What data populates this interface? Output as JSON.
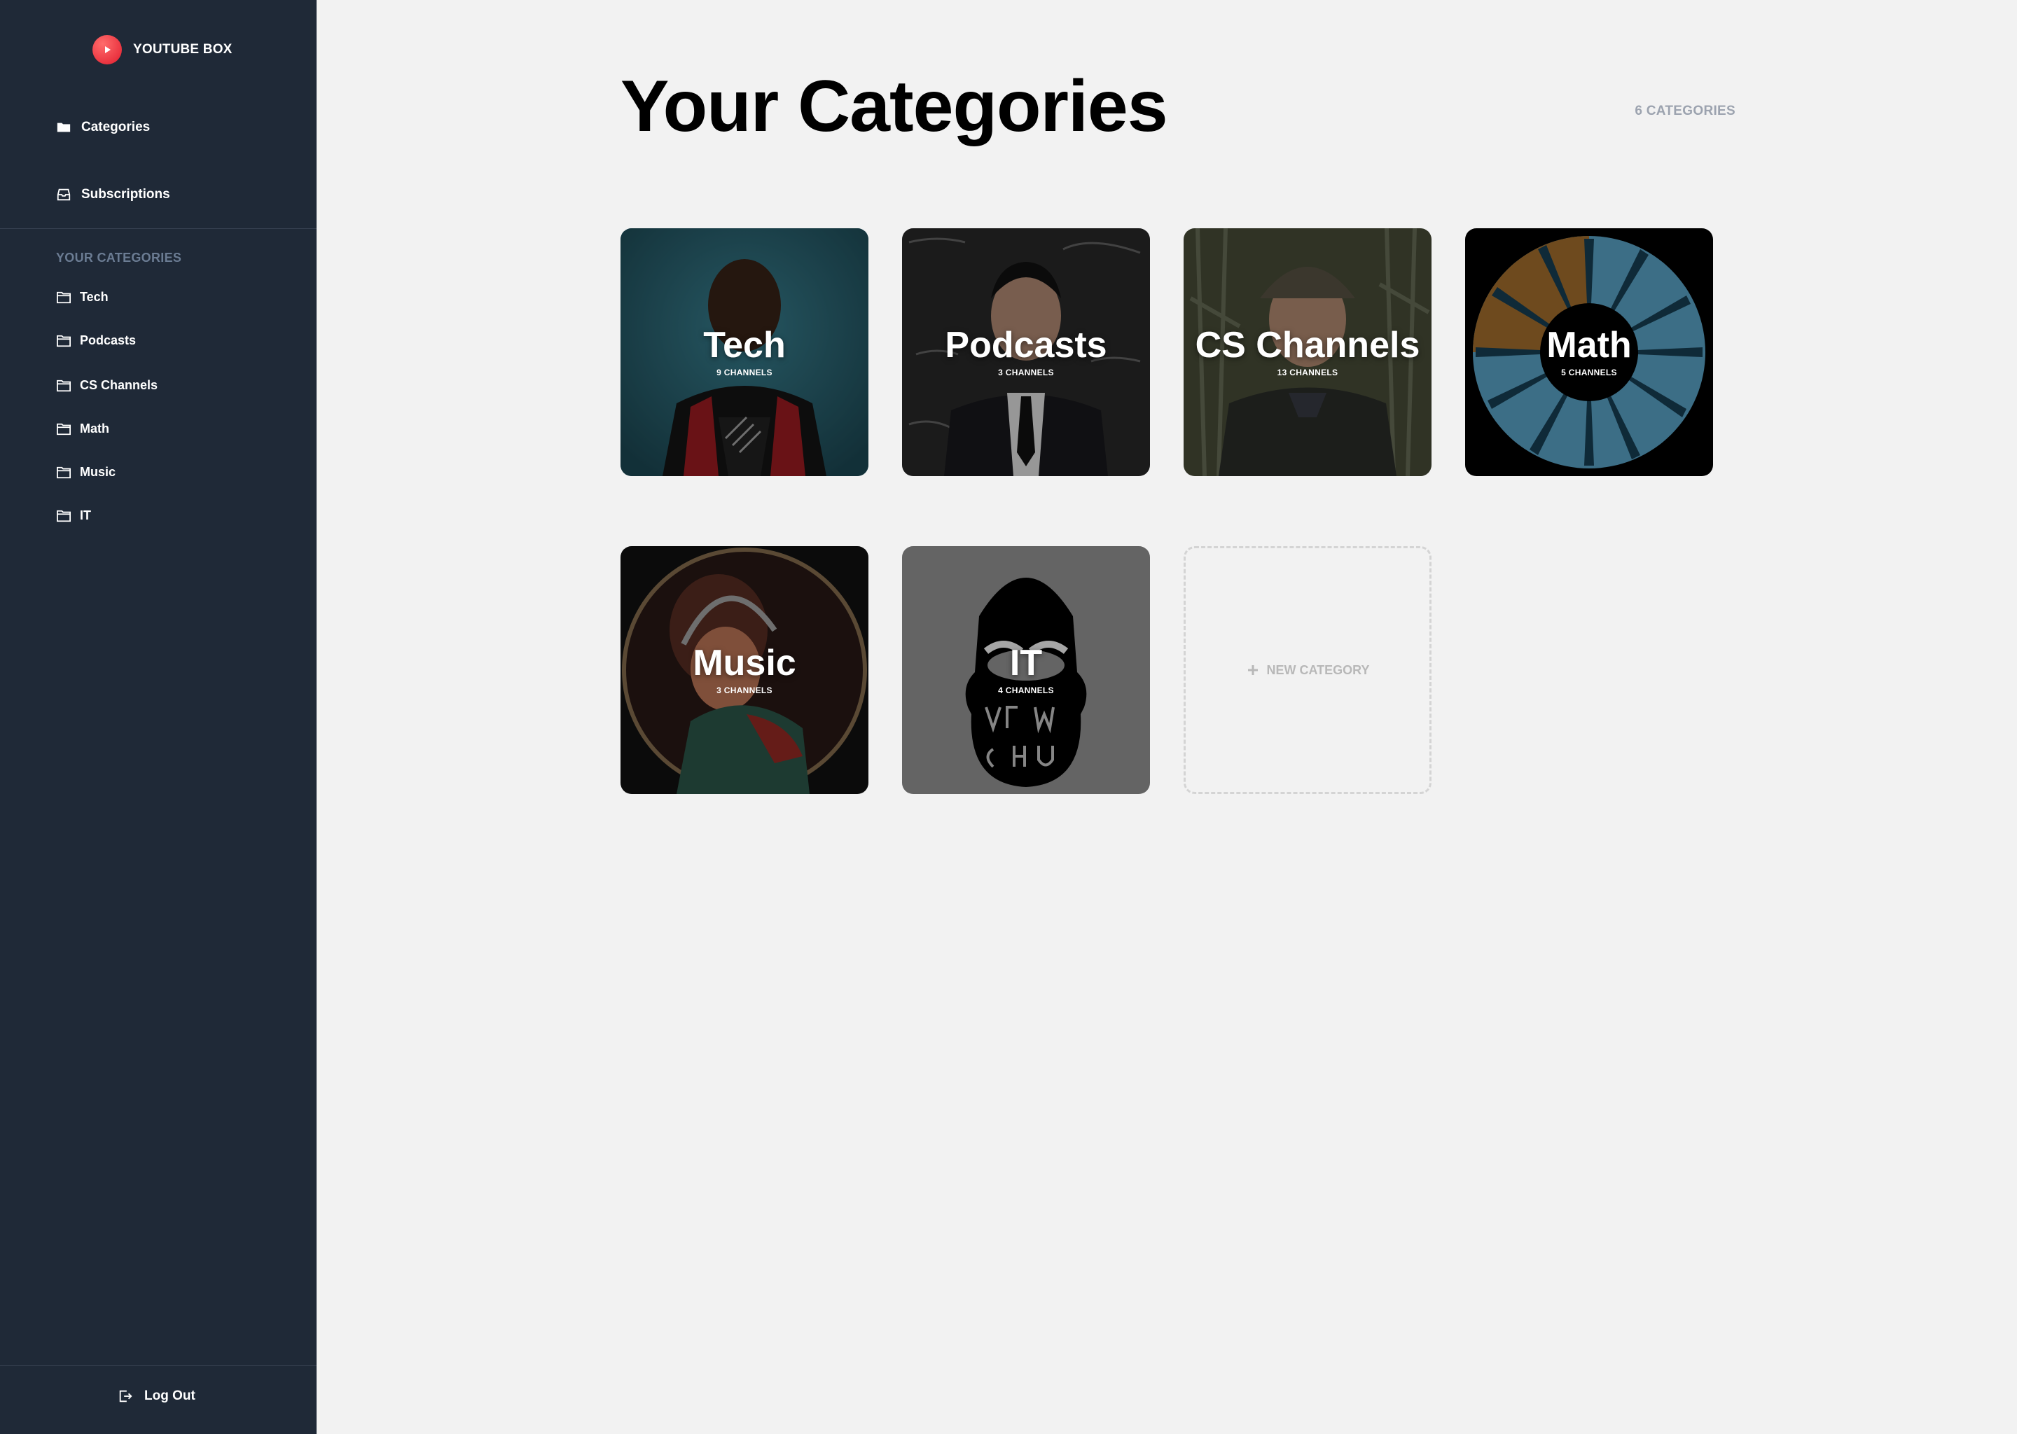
{
  "brand": {
    "name": "YOUTUBE BOX",
    "color": "#e11d2e"
  },
  "nav": {
    "categories_label": "Categories",
    "subscriptions_label": "Subscriptions"
  },
  "sidebar": {
    "section_label": "YOUR CATEGORIES",
    "items": [
      {
        "label": "Tech"
      },
      {
        "label": "Podcasts"
      },
      {
        "label": "CS Channels"
      },
      {
        "label": "Math"
      },
      {
        "label": "Music"
      },
      {
        "label": "IT"
      }
    ],
    "logout_label": "Log Out"
  },
  "main": {
    "title": "Your Categories",
    "count": "6 CATEGORIES",
    "cards": [
      {
        "name": "Tech",
        "channels": "9 CHANNELS"
      },
      {
        "name": "Podcasts",
        "channels": "3 CHANNELS"
      },
      {
        "name": "CS Channels",
        "channels": "13 CHANNELS"
      },
      {
        "name": "Math",
        "channels": "5 CHANNELS"
      },
      {
        "name": "Music",
        "channels": "3 CHANNELS"
      },
      {
        "name": "IT",
        "channels": "4 CHANNELS"
      }
    ],
    "new_category_label": "NEW CATEGORY"
  },
  "theme": {
    "sidebar_bg": "#1f2937",
    "page_bg": "#f2f2f2"
  }
}
